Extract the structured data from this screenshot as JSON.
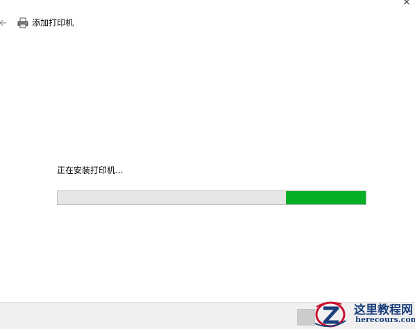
{
  "window": {
    "close_glyph": "×"
  },
  "header": {
    "back_icon": "back-arrow-icon",
    "printer_icon": "printer-icon",
    "title": "添加打印机"
  },
  "main": {
    "status_text": "正在安装打印机...",
    "progress": {
      "fill_start_fraction": 0.74,
      "fill_end_fraction": 1.0,
      "track_color": "#e6e6e6",
      "fill_color": "#06b025"
    }
  },
  "watermark": {
    "title": "这里教程网",
    "url": "herecours.com"
  },
  "colors": {
    "watermark_text": "#1a3f7a",
    "watermark_red": "#c8102e"
  }
}
